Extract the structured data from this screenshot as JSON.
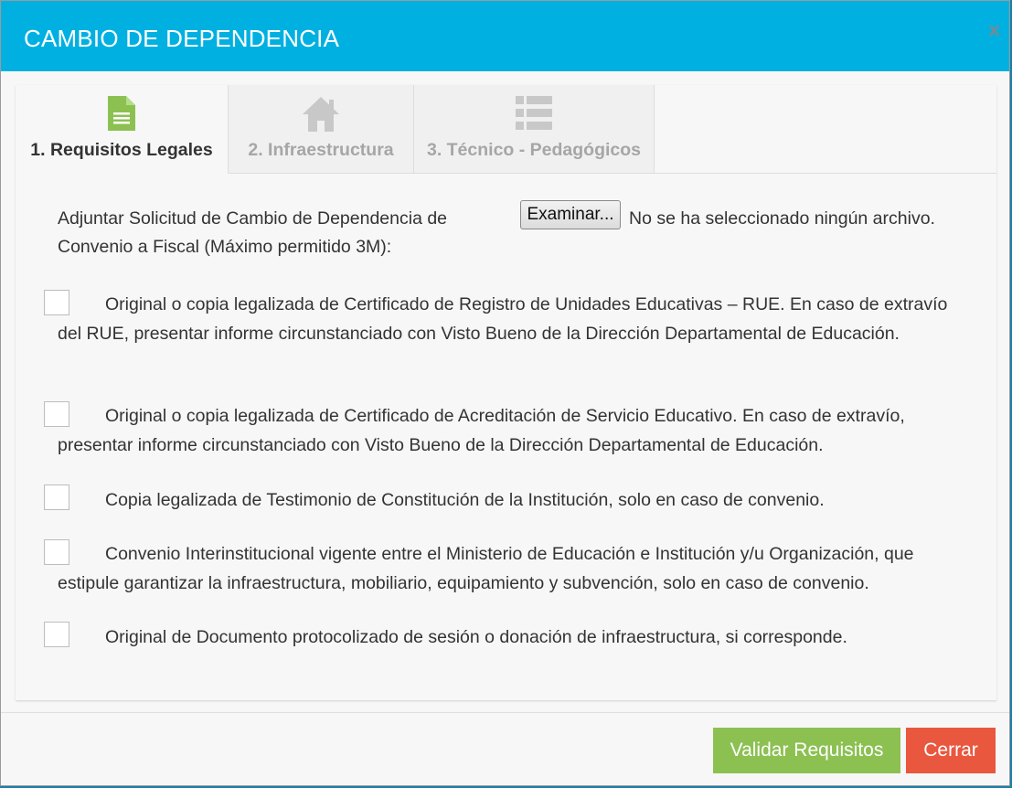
{
  "modal": {
    "title": "CAMBIO DE DEPENDENCIA",
    "close_label": "x"
  },
  "tabs": [
    {
      "label": "1. Requisitos Legales",
      "icon": "document-icon",
      "active": true,
      "icon_color": "#8cc152"
    },
    {
      "label": "2. Infraestructura",
      "icon": "home-icon",
      "active": false,
      "icon_color": "#c8c8c8"
    },
    {
      "label": "3. Técnico - Pedagógicos",
      "icon": "list-icon",
      "active": false,
      "icon_color": "#c8c8c8"
    }
  ],
  "attachment": {
    "label": "Adjuntar Solicitud de Cambio de Dependencia de Convenio a Fiscal (Máximo permitido 3M):",
    "button_label": "Examinar...",
    "status": "No se ha seleccionado ningún archivo."
  },
  "requirements": [
    {
      "text": "Original o copia legalizada de Certificado de Registro de Unidades Educativas – RUE. En caso de extravío del RUE, presentar informe circunstanciado con Visto Bueno de la Dirección Departamental de Educación.",
      "checked": false
    },
    {
      "text": "Original o copia legalizada de Certificado de Acreditación de Servicio Educativo. En caso de extravío, presentar informe circunstanciado con Visto Bueno de la Dirección Departamental de Educación.",
      "checked": false
    },
    {
      "text": "Copia legalizada de Testimonio de Constitución de la Institución, solo en caso de convenio.",
      "checked": false
    },
    {
      "text": "Convenio Interinstitucional vigente entre el Ministerio de Educación e Institución y/u Organización, que estipule garantizar la infraestructura, mobiliario, equipamiento y subvención, solo en caso de convenio.",
      "checked": false
    },
    {
      "text": "Original de Documento protocolizado de sesión o donación de infraestructura, si corresponde.",
      "checked": false
    }
  ],
  "footer": {
    "validate_label": "Validar Requisitos",
    "close_label": "Cerrar"
  },
  "colors": {
    "header": "#00b0e1",
    "validate": "#8cc152",
    "close": "#e9573f"
  }
}
